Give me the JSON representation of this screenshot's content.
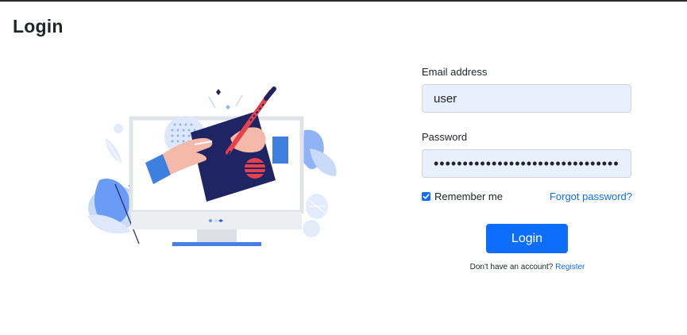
{
  "page": {
    "title": "Login"
  },
  "form": {
    "email_label": "Email address",
    "email_value": "user",
    "password_label": "Password",
    "password_value": "••••••••••••••••••••••••••••••••••",
    "remember_label": "Remember me",
    "remember_checked": true,
    "forgot_link": "Forgot password?",
    "login_button": "Login",
    "register_prompt": "Don't have an account?",
    "register_link": "Register"
  },
  "colors": {
    "accent": "#0d6efd",
    "input_bg": "#e8f0fe",
    "illustration_navy": "#1f2563",
    "illustration_blue": "#6b9cf5",
    "illustration_red": "#e8414e"
  },
  "icons": {
    "illustration": "login-illustration",
    "checkbox": "checkmark-icon"
  }
}
